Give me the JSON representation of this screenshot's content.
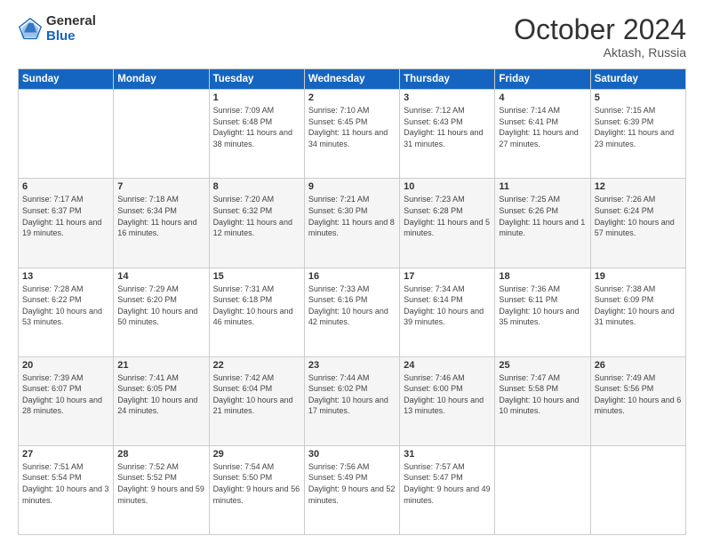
{
  "logo": {
    "general": "General",
    "blue": "Blue"
  },
  "title": {
    "month": "October 2024",
    "location": "Aktash, Russia"
  },
  "headers": [
    "Sunday",
    "Monday",
    "Tuesday",
    "Wednesday",
    "Thursday",
    "Friday",
    "Saturday"
  ],
  "weeks": [
    [
      {
        "day": "",
        "sunrise": "",
        "sunset": "",
        "daylight": ""
      },
      {
        "day": "",
        "sunrise": "",
        "sunset": "",
        "daylight": ""
      },
      {
        "day": "1",
        "sunrise": "Sunrise: 7:09 AM",
        "sunset": "Sunset: 6:48 PM",
        "daylight": "Daylight: 11 hours and 38 minutes."
      },
      {
        "day": "2",
        "sunrise": "Sunrise: 7:10 AM",
        "sunset": "Sunset: 6:45 PM",
        "daylight": "Daylight: 11 hours and 34 minutes."
      },
      {
        "day": "3",
        "sunrise": "Sunrise: 7:12 AM",
        "sunset": "Sunset: 6:43 PM",
        "daylight": "Daylight: 11 hours and 31 minutes."
      },
      {
        "day": "4",
        "sunrise": "Sunrise: 7:14 AM",
        "sunset": "Sunset: 6:41 PM",
        "daylight": "Daylight: 11 hours and 27 minutes."
      },
      {
        "day": "5",
        "sunrise": "Sunrise: 7:15 AM",
        "sunset": "Sunset: 6:39 PM",
        "daylight": "Daylight: 11 hours and 23 minutes."
      }
    ],
    [
      {
        "day": "6",
        "sunrise": "Sunrise: 7:17 AM",
        "sunset": "Sunset: 6:37 PM",
        "daylight": "Daylight: 11 hours and 19 minutes."
      },
      {
        "day": "7",
        "sunrise": "Sunrise: 7:18 AM",
        "sunset": "Sunset: 6:34 PM",
        "daylight": "Daylight: 11 hours and 16 minutes."
      },
      {
        "day": "8",
        "sunrise": "Sunrise: 7:20 AM",
        "sunset": "Sunset: 6:32 PM",
        "daylight": "Daylight: 11 hours and 12 minutes."
      },
      {
        "day": "9",
        "sunrise": "Sunrise: 7:21 AM",
        "sunset": "Sunset: 6:30 PM",
        "daylight": "Daylight: 11 hours and 8 minutes."
      },
      {
        "day": "10",
        "sunrise": "Sunrise: 7:23 AM",
        "sunset": "Sunset: 6:28 PM",
        "daylight": "Daylight: 11 hours and 5 minutes."
      },
      {
        "day": "11",
        "sunrise": "Sunrise: 7:25 AM",
        "sunset": "Sunset: 6:26 PM",
        "daylight": "Daylight: 11 hours and 1 minute."
      },
      {
        "day": "12",
        "sunrise": "Sunrise: 7:26 AM",
        "sunset": "Sunset: 6:24 PM",
        "daylight": "Daylight: 10 hours and 57 minutes."
      }
    ],
    [
      {
        "day": "13",
        "sunrise": "Sunrise: 7:28 AM",
        "sunset": "Sunset: 6:22 PM",
        "daylight": "Daylight: 10 hours and 53 minutes."
      },
      {
        "day": "14",
        "sunrise": "Sunrise: 7:29 AM",
        "sunset": "Sunset: 6:20 PM",
        "daylight": "Daylight: 10 hours and 50 minutes."
      },
      {
        "day": "15",
        "sunrise": "Sunrise: 7:31 AM",
        "sunset": "Sunset: 6:18 PM",
        "daylight": "Daylight: 10 hours and 46 minutes."
      },
      {
        "day": "16",
        "sunrise": "Sunrise: 7:33 AM",
        "sunset": "Sunset: 6:16 PM",
        "daylight": "Daylight: 10 hours and 42 minutes."
      },
      {
        "day": "17",
        "sunrise": "Sunrise: 7:34 AM",
        "sunset": "Sunset: 6:14 PM",
        "daylight": "Daylight: 10 hours and 39 minutes."
      },
      {
        "day": "18",
        "sunrise": "Sunrise: 7:36 AM",
        "sunset": "Sunset: 6:11 PM",
        "daylight": "Daylight: 10 hours and 35 minutes."
      },
      {
        "day": "19",
        "sunrise": "Sunrise: 7:38 AM",
        "sunset": "Sunset: 6:09 PM",
        "daylight": "Daylight: 10 hours and 31 minutes."
      }
    ],
    [
      {
        "day": "20",
        "sunrise": "Sunrise: 7:39 AM",
        "sunset": "Sunset: 6:07 PM",
        "daylight": "Daylight: 10 hours and 28 minutes."
      },
      {
        "day": "21",
        "sunrise": "Sunrise: 7:41 AM",
        "sunset": "Sunset: 6:05 PM",
        "daylight": "Daylight: 10 hours and 24 minutes."
      },
      {
        "day": "22",
        "sunrise": "Sunrise: 7:42 AM",
        "sunset": "Sunset: 6:04 PM",
        "daylight": "Daylight: 10 hours and 21 minutes."
      },
      {
        "day": "23",
        "sunrise": "Sunrise: 7:44 AM",
        "sunset": "Sunset: 6:02 PM",
        "daylight": "Daylight: 10 hours and 17 minutes."
      },
      {
        "day": "24",
        "sunrise": "Sunrise: 7:46 AM",
        "sunset": "Sunset: 6:00 PM",
        "daylight": "Daylight: 10 hours and 13 minutes."
      },
      {
        "day": "25",
        "sunrise": "Sunrise: 7:47 AM",
        "sunset": "Sunset: 5:58 PM",
        "daylight": "Daylight: 10 hours and 10 minutes."
      },
      {
        "day": "26",
        "sunrise": "Sunrise: 7:49 AM",
        "sunset": "Sunset: 5:56 PM",
        "daylight": "Daylight: 10 hours and 6 minutes."
      }
    ],
    [
      {
        "day": "27",
        "sunrise": "Sunrise: 7:51 AM",
        "sunset": "Sunset: 5:54 PM",
        "daylight": "Daylight: 10 hours and 3 minutes."
      },
      {
        "day": "28",
        "sunrise": "Sunrise: 7:52 AM",
        "sunset": "Sunset: 5:52 PM",
        "daylight": "Daylight: 9 hours and 59 minutes."
      },
      {
        "day": "29",
        "sunrise": "Sunrise: 7:54 AM",
        "sunset": "Sunset: 5:50 PM",
        "daylight": "Daylight: 9 hours and 56 minutes."
      },
      {
        "day": "30",
        "sunrise": "Sunrise: 7:56 AM",
        "sunset": "Sunset: 5:49 PM",
        "daylight": "Daylight: 9 hours and 52 minutes."
      },
      {
        "day": "31",
        "sunrise": "Sunrise: 7:57 AM",
        "sunset": "Sunset: 5:47 PM",
        "daylight": "Daylight: 9 hours and 49 minutes."
      },
      {
        "day": "",
        "sunrise": "",
        "sunset": "",
        "daylight": ""
      },
      {
        "day": "",
        "sunrise": "",
        "sunset": "",
        "daylight": ""
      }
    ]
  ]
}
